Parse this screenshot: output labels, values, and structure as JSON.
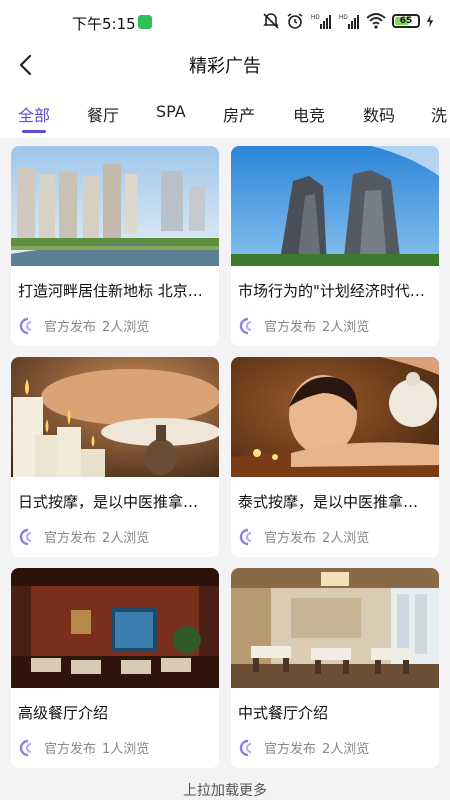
{
  "status_bar": {
    "time": "下午5:15",
    "battery": "65",
    "battery_level": 0.65,
    "net_label_1": "HD",
    "net_label_2": "HD"
  },
  "nav": {
    "title": "精彩广告",
    "back_icon": "chevron-left-icon"
  },
  "tabs": [
    {
      "label": "全部",
      "active": true
    },
    {
      "label": "餐厅",
      "active": false
    },
    {
      "label": "SPA",
      "active": false
    },
    {
      "label": "房产",
      "active": false
    },
    {
      "label": "电竞",
      "active": false
    },
    {
      "label": "数码",
      "active": false
    },
    {
      "label": "洗",
      "active": false
    }
  ],
  "cards": [
    {
      "title": "打造河畔居住新地标 北京…",
      "publisher": "官方发布",
      "views": "2人浏览",
      "image": "riverside-buildings"
    },
    {
      "title": "市场行为的\"计划经济时代…",
      "publisher": "官方发布",
      "views": "2人浏览",
      "image": "high-rise-towers"
    },
    {
      "title": "日式按摩，是以中医推拿…",
      "publisher": "官方发布",
      "views": "2人浏览",
      "image": "candles-spa"
    },
    {
      "title": "泰式按摩，是以中医推拿…",
      "publisher": "官方发布",
      "views": "2人浏览",
      "image": "herbal-compress-massage"
    },
    {
      "title": "高级餐厅介绍",
      "publisher": "官方发布",
      "views": "1人浏览",
      "image": "luxury-restaurant"
    },
    {
      "title": "中式餐厅介绍",
      "publisher": "官方发布",
      "views": "2人浏览",
      "image": "chinese-restaurant"
    }
  ],
  "footer": {
    "load_more": "上拉加载更多"
  },
  "colors": {
    "accent": "#5b4fd6",
    "background": "#f3f3f6",
    "meta_text": "#888888"
  }
}
